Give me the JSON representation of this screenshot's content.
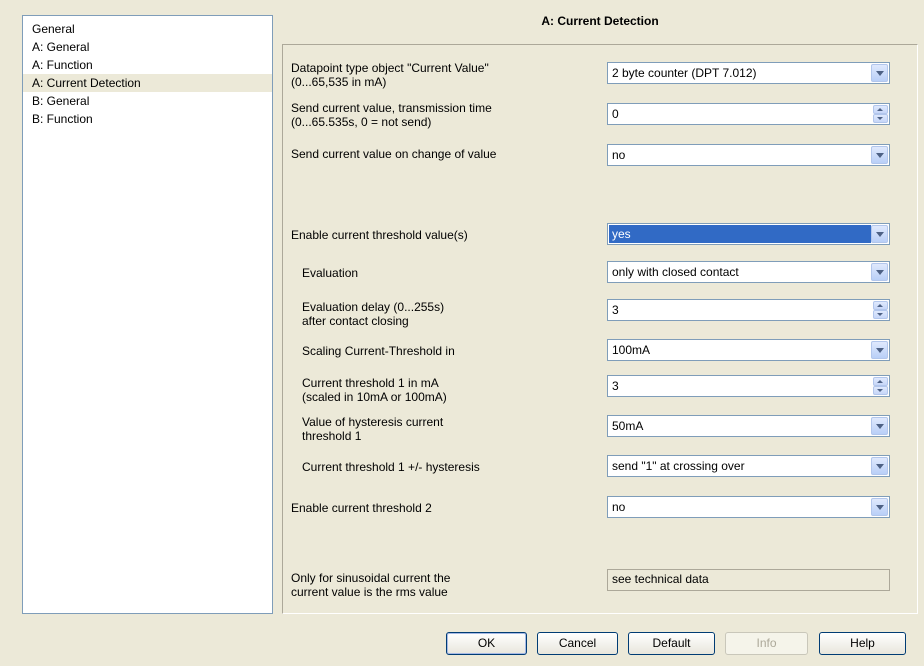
{
  "sidebar": {
    "items": [
      {
        "label": "General"
      },
      {
        "label": "A: General"
      },
      {
        "label": "A: Function"
      },
      {
        "label": "A: Current Detection"
      },
      {
        "label": "B: General"
      },
      {
        "label": "B: Function"
      }
    ]
  },
  "panel": {
    "title": "A: Current Detection",
    "params": [
      {
        "label1": "Datapoint type object \"Current Value\"",
        "label2": "(0...65,535 in mA)",
        "value": "2 byte counter (DPT 7.012)",
        "control": "dropdown"
      },
      {
        "label1": "Send current value, transmission time",
        "label2": "(0...65.535s, 0 = not send)",
        "value": "0",
        "control": "spinner"
      },
      {
        "label1": "Send current value on change of value",
        "value": "no",
        "control": "dropdown"
      },
      {
        "label1": "Enable current threshold value(s)",
        "value": "yes",
        "control": "dropdown"
      },
      {
        "label1": "Evaluation",
        "value": "only with closed contact",
        "control": "dropdown"
      },
      {
        "label1": "Evaluation delay (0...255s)",
        "label2": "after contact closing",
        "value": "3",
        "control": "spinner"
      },
      {
        "label1": "Scaling Current-Threshold in",
        "value": "100mA",
        "control": "dropdown"
      },
      {
        "label1": "Current threshold 1 in mA",
        "label2": " (scaled in 10mA or 100mA)",
        "value": "3",
        "control": "spinner"
      },
      {
        "label1": "Value of hysteresis current",
        "label2": "threshold 1",
        "value": "50mA",
        "control": "dropdown"
      },
      {
        "label1": "Current threshold 1 +/- hysteresis",
        "value": "send \"1\" at crossing over",
        "control": "dropdown"
      },
      {
        "label1": "Enable current threshold 2",
        "value": "no",
        "control": "dropdown"
      },
      {
        "label1": "Only for sinusoidal current the",
        "label2": "current value is the rms value",
        "value": "see technical data",
        "control": "readonly"
      }
    ]
  },
  "buttons": {
    "ok": "OK",
    "cancel": "Cancel",
    "default": "Default",
    "info": "Info",
    "help": "Help"
  }
}
